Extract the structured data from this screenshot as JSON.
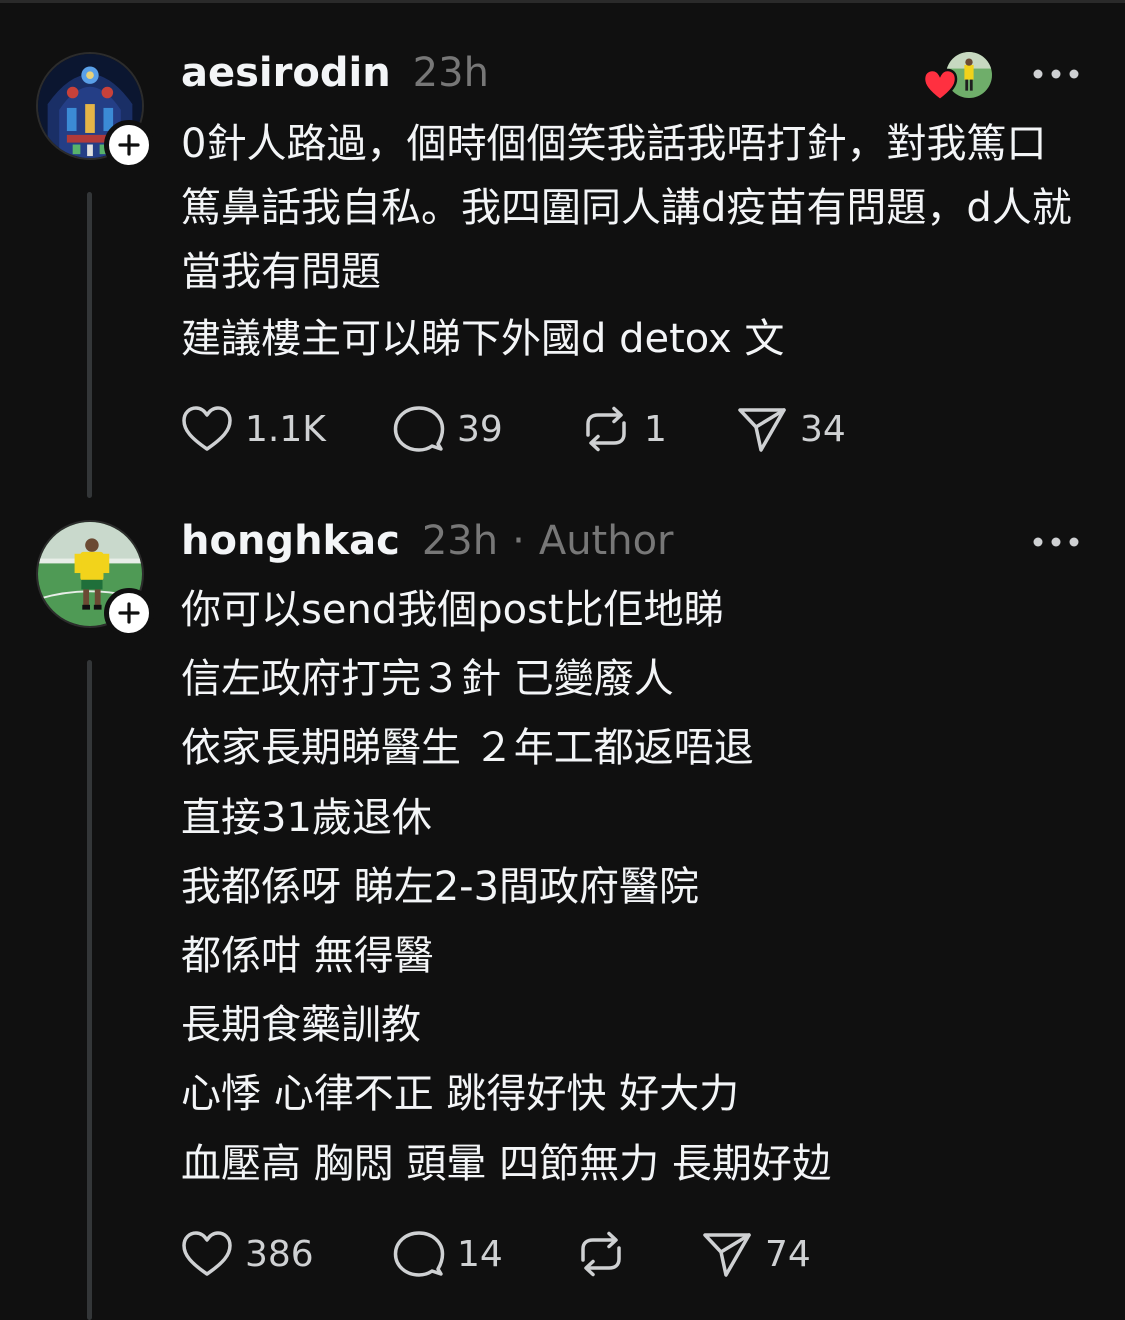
{
  "theme": {
    "background": "#101010",
    "text": "#f3f5f7",
    "muted": "#777777",
    "heart": "#ff3040"
  },
  "posts": [
    {
      "username": "aesirodin",
      "time": "23h",
      "avatar_icon": "stained-glass-avatar",
      "follow_icon": "plus-icon",
      "has_liker": true,
      "liker_icon": "heart-icon",
      "paragraphs": [
        "0針人路過，個時個個笑我話我唔打針，對我篤口篤鼻話我自私。我四圍同人講d疫苗有問題，d人就當我有問題",
        "建議樓主可以睇下外國d detox 文"
      ],
      "stats": {
        "likes": "1.1K",
        "replies": "39",
        "reposts": "1",
        "shares": "34"
      }
    },
    {
      "username": "honghkac",
      "time": "23h",
      "separator": "·",
      "author_tag": "Author",
      "avatar_icon": "soccer-player-avatar",
      "follow_icon": "plus-icon",
      "lines": [
        "你可以send我個post比佢地睇",
        "信左政府打完３針 已變廢人",
        "依家長期睇醫生 ２年工都返唔退",
        "直接31歲退休",
        "我都係呀 睇左2-3間政府醫院",
        "都係咁 無得醫",
        "長期食藥訓教",
        "心悸 心律不正 跳得好快 好大力",
        "血壓高 胸悶 頭暈 四節無力 長期好攰"
      ],
      "stats": {
        "likes": "386",
        "replies": "14",
        "reposts": "",
        "shares": "74"
      }
    }
  ]
}
